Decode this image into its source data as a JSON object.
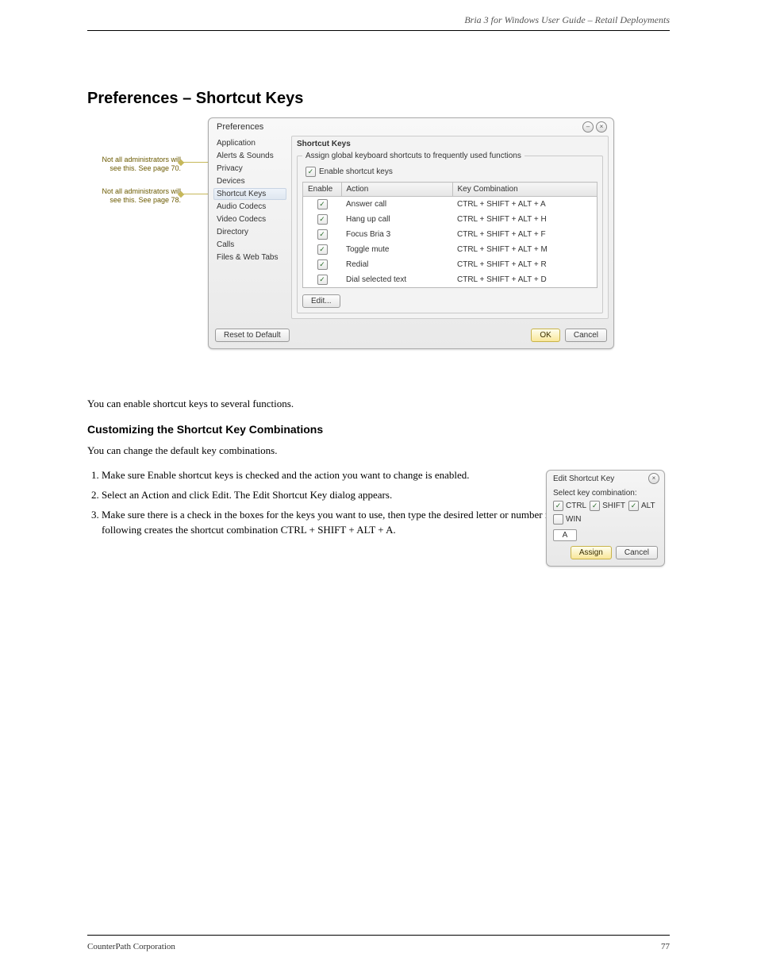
{
  "doc": {
    "header_right": "Bria 3 for Windows User Guide – Retail Deployments",
    "section_heading": "Preferences – Shortcut Keys",
    "p1": "You can enable shortcut keys to several functions.",
    "customizing_heading": "Customizing the Shortcut Key Combinations",
    "p2": "You can change the default key combinations.",
    "steps": [
      "Make sure Enable shortcut keys is checked and the action you want to change is enabled.",
      "Select an Action and click Edit. The Edit Shortcut Key dialog appears.",
      "Make sure there is a check in the boxes for the keys you want to use, then type the desired letter or number in the field. For example, the following creates the shortcut combination CTRL + SHIFT + ALT + A."
    ],
    "footer_left": "CounterPath Corporation",
    "footer_right": "77"
  },
  "callouts": {
    "c1": "Not all administrators will see this. See page 70.",
    "c2": "Not all administrators will see this. See page 78."
  },
  "dialog": {
    "title": "Preferences",
    "sidebar": [
      "Application",
      "Alerts & Sounds",
      "Privacy",
      "Devices",
      "Shortcut Keys",
      "Audio Codecs",
      "Video Codecs",
      "Directory",
      "Calls",
      "Files & Web Tabs"
    ],
    "panel_title": "Shortcut Keys",
    "group_legend": "Assign global keyboard shortcuts to frequently used functions",
    "enable_label": "Enable shortcut keys",
    "columns": {
      "enable": "Enable",
      "action": "Action",
      "key": "Key Combination"
    },
    "rows": [
      {
        "action": "Answer call",
        "key": "CTRL + SHIFT + ALT + A"
      },
      {
        "action": "Hang up call",
        "key": "CTRL + SHIFT + ALT + H"
      },
      {
        "action": "Focus Bria 3",
        "key": "CTRL + SHIFT + ALT + F"
      },
      {
        "action": "Toggle mute",
        "key": "CTRL + SHIFT + ALT + M"
      },
      {
        "action": "Redial",
        "key": "CTRL + SHIFT + ALT + R"
      },
      {
        "action": "Dial selected text",
        "key": "CTRL + SHIFT + ALT + D"
      }
    ],
    "edit_btn": "Edit...",
    "reset_btn": "Reset to Default",
    "ok_btn": "OK",
    "cancel_btn": "Cancel"
  },
  "mini": {
    "title": "Edit Shortcut Key",
    "prompt": "Select key combination:",
    "mods": {
      "ctrl": "CTRL",
      "shift": "SHIFT",
      "alt": "ALT",
      "win": "WIN"
    },
    "key_value": "A",
    "assign_btn": "Assign",
    "cancel_btn": "Cancel"
  }
}
